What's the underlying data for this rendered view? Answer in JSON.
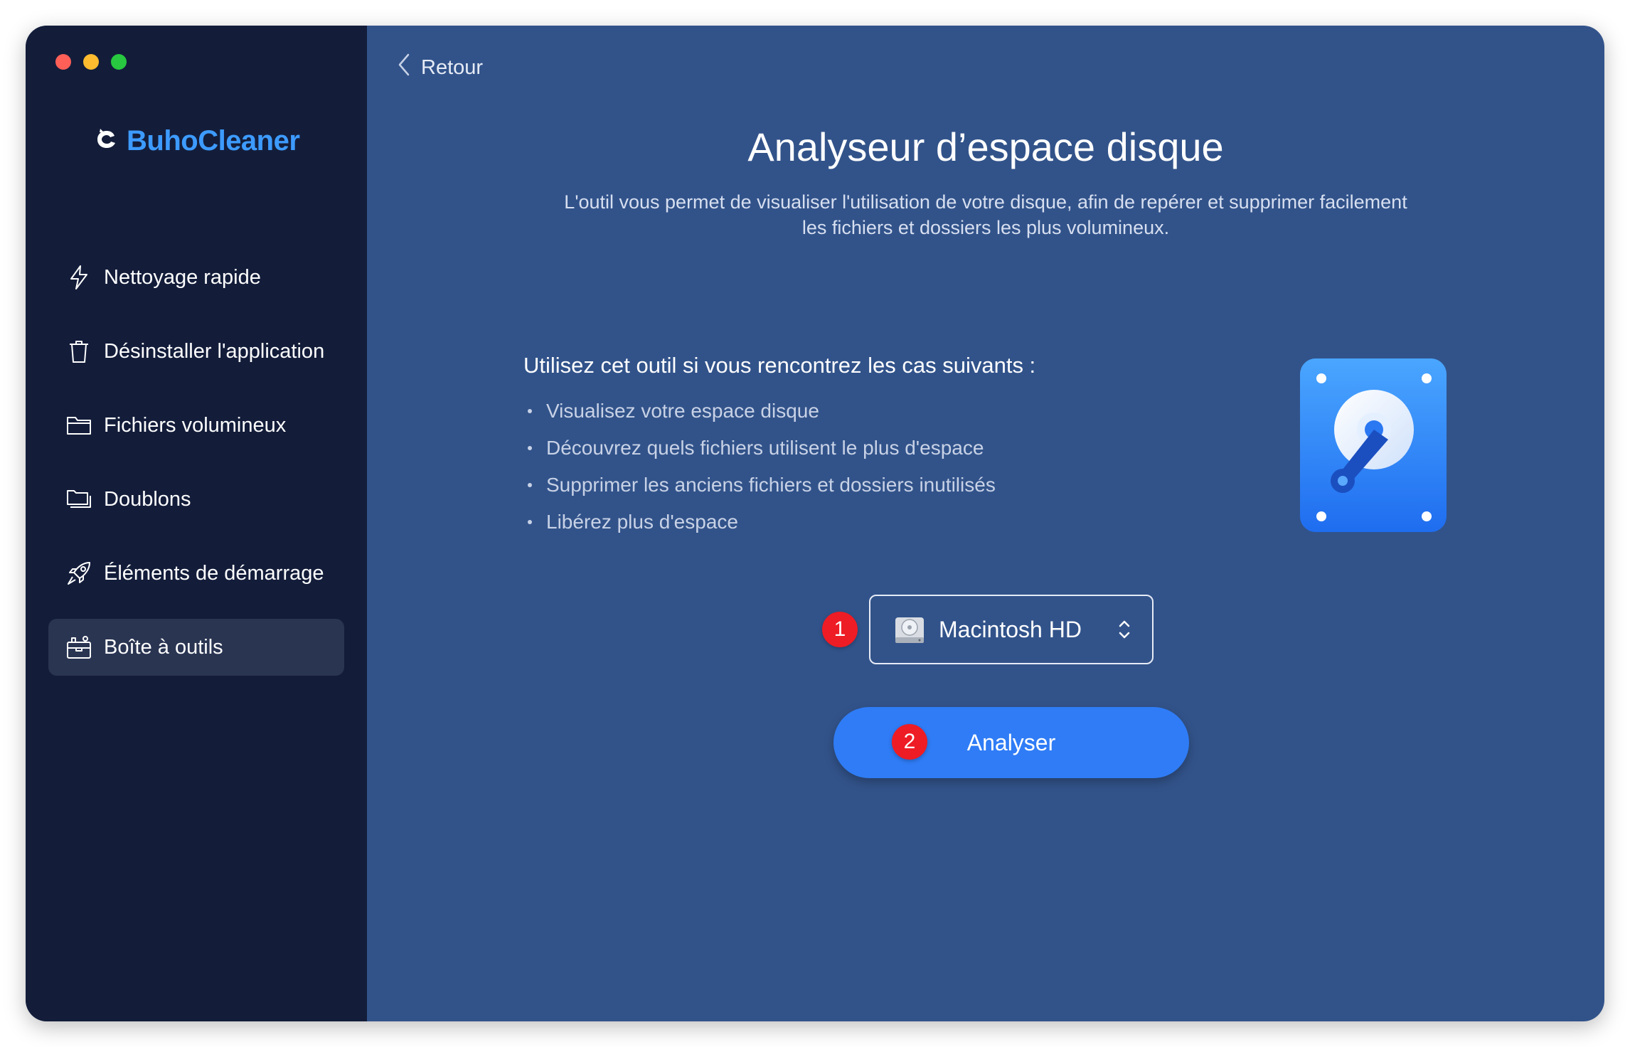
{
  "window": {
    "traffic_lights": [
      "#fe5f57",
      "#febc2e",
      "#28c840"
    ]
  },
  "sidebar": {
    "brand": "BuhoCleaner",
    "brand_color": "#3d9bff",
    "items": [
      {
        "label": "Nettoyage rapide",
        "icon": "lightning-icon",
        "active": false
      },
      {
        "label": "Désinstaller l'application",
        "icon": "trash-icon",
        "active": false
      },
      {
        "label": "Fichiers volumineux",
        "icon": "folder-icon",
        "active": false
      },
      {
        "label": "Doublons",
        "icon": "duplicate-folder-icon",
        "active": false
      },
      {
        "label": "Éléments de démarrage",
        "icon": "rocket-icon",
        "active": false
      },
      {
        "label": "Boîte à outils",
        "icon": "toolbox-icon",
        "active": true
      }
    ]
  },
  "main": {
    "back_label": "Retour",
    "title": "Analyseur d’espace disque",
    "subtitle_line1": "L'outil vous permet de visualiser l'utilisation de votre disque, afin de repérer et supprimer facilement",
    "subtitle_line2": "les fichiers et dossiers les plus volumineux.",
    "usecase_heading": "Utilisez cet outil si vous rencontrez les cas suivants :",
    "usecases": [
      "Visualisez votre espace disque",
      "Découvrez quels fichiers utilisent le plus d'espace",
      "Supprimer les anciens fichiers et dossiers inutilisés",
      "Libérez plus d'espace"
    ],
    "hero_icon": "disk-analyzer-icon",
    "disk_select": {
      "value": "Macintosh HD",
      "badge": "1"
    },
    "analyze_button": {
      "label": "Analyser",
      "badge": "2",
      "color": "#2f7cf6"
    }
  }
}
